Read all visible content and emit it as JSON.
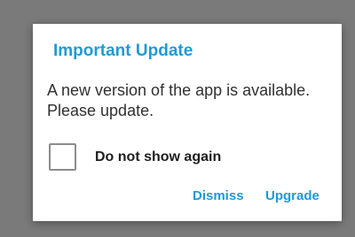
{
  "dialog": {
    "title": "Important Update",
    "message": "A new version of the app is available. Please update.",
    "checkbox": {
      "label": "Do not show again",
      "checked": false
    },
    "buttons": {
      "dismiss": "Dismiss",
      "upgrade": "Upgrade"
    }
  },
  "colors": {
    "accent": "#1f9ad6",
    "overlay": "#7a7a7a",
    "dialog_background": "#ffffff",
    "text": "#303030"
  }
}
